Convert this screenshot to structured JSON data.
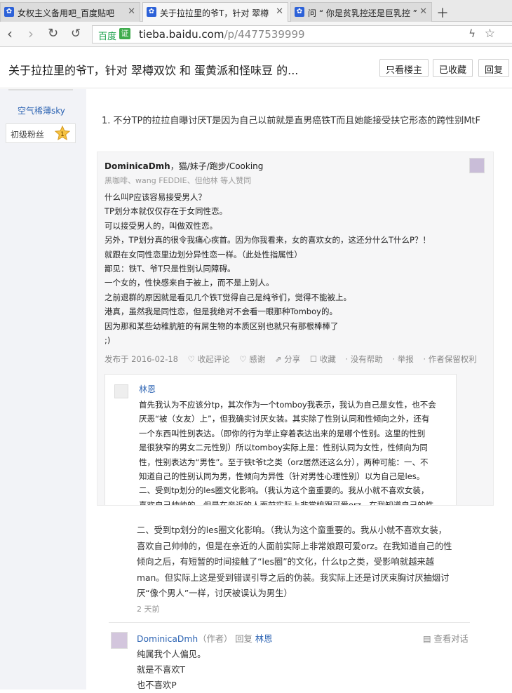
{
  "tabs": [
    {
      "title": "女权主义备用吧_百度贴吧"
    },
    {
      "title": "关于拉拉里的爷T，针对 翠樽"
    },
    {
      "title": "问 “ 你是贫乳控还是巨乳控 ”"
    }
  ],
  "address": {
    "brand": "百度",
    "badge": "证",
    "domain": "tieba.baidu.com",
    "path": "/p/4477539999"
  },
  "thread": {
    "title": "关于拉拉里的爷T，针对 翠樽双饮 和 蛋黄派和怪味豆 的...",
    "btn_only_op": "只看楼主",
    "btn_collected": "已收藏",
    "btn_reply": "回复"
  },
  "sidebar": {
    "username": "空气稀薄sky",
    "badge_text": "初级粉丝",
    "badge_level": "1"
  },
  "post": {
    "line1": "1. 不分TP的拉拉自曝讨厌T是因为自己以前就是直男癌铁T而且她能接受扶它形态的跨性别MtF"
  },
  "screenshot": {
    "author": "DominicaDmh",
    "author_tags": "，猫/妹子/跑步/Cooking",
    "likes": "黑咖啡、wang FEDDIE、但他林 等人赞同",
    "lines": [
      "什么叫P应该容易接受男人？",
      "TP划分本就仅仅存在于女同性恋。",
      "可以接受男人的，叫做双性恋。",
      "另外，TP划分真的很令我痛心疾首。因为你我看来，女的喜欢女的，这还分什么T什么P？！",
      "就跟在女同性恋里边划分异性恋一样。（此处性指属性）",
      "鄙见：铁T、爷T只是性别认同障碍。",
      "一个女的，性快感来自于被上，而不是上别人。",
      "之前退群的原因就是看见几个铁T觉得自己是纯爷们，觉得不能被上。",
      "港真，虽然我是同性恋，但是我绝对不会看一眼那种Tomboy的。",
      "因为那和某些幼稚肮脏的有屌生物的本质区别也就只有那根棒棒了",
      ";)"
    ],
    "meta": [
      "发布于 2016-02-18",
      "♡ 收起评论",
      "♡ 感谢",
      "⇗ 分享",
      "☐ 收藏",
      "· 没有帮助",
      "· 举报",
      "· 作者保留权利"
    ],
    "reply_name": "林恩",
    "reply_lines": [
      "首先我认为不应该分tp，其次作为一个tomboy我表示，我认为自己是女性，也不会",
      "厌恶“被（女友）上”，但我确实讨厌女装。其实除了性别认同和性倾向之外，还有",
      "一个东西叫性别表达。（即你的行为举止穿着表达出来的是哪个性别。这里的性别",
      "是很狭窄的男女二元性别）所以tomboy实际上是：性别认同为女性，性倾向为同",
      "性，性别表达为“男性”。至于铁t爷t之类（orz居然还这么分），两种可能：一、不",
      "知道自己的性别认同为男，性倾向为异性（针对男性心理性别）以为自己是les。",
      "二、受到tp划分的les圈文化影响。（我认为这个蛮重要的。我从小就不喜欢女装，",
      "喜欢自己帅帅的，但是在亲近的人面前实际上非常娘跟可爱orz。在我知道自己的性"
    ]
  },
  "comment1": {
    "lines": [
      "二、受到tp划分的les圈文化影响。（我认为这个蛮重要的。我从小就不喜欢女装，",
      "喜欢自己帅帅的，但是在亲近的人面前实际上非常娘跟可爱orz。在我知道自己的性",
      "倾向之后，有短暂的时间接触了“les圈”的文化，什么tp之类，受影响就越来越",
      "man。但实际上这是受到错误引导之后的伪装。我实际上还是讨厌束胸讨厌抽烟讨",
      "厌“像个男人”一样，讨厌被误认为男生）"
    ],
    "time": "2 天前"
  },
  "comment2": {
    "author": "DominicaDmh",
    "role": "（作者）",
    "reply_word": "回复",
    "reply_to": "林恩",
    "view_conv": "查看对话",
    "lines": [
      "纯属我个人偏见。",
      "就是不喜欢T",
      "也不喜欢P"
    ]
  }
}
